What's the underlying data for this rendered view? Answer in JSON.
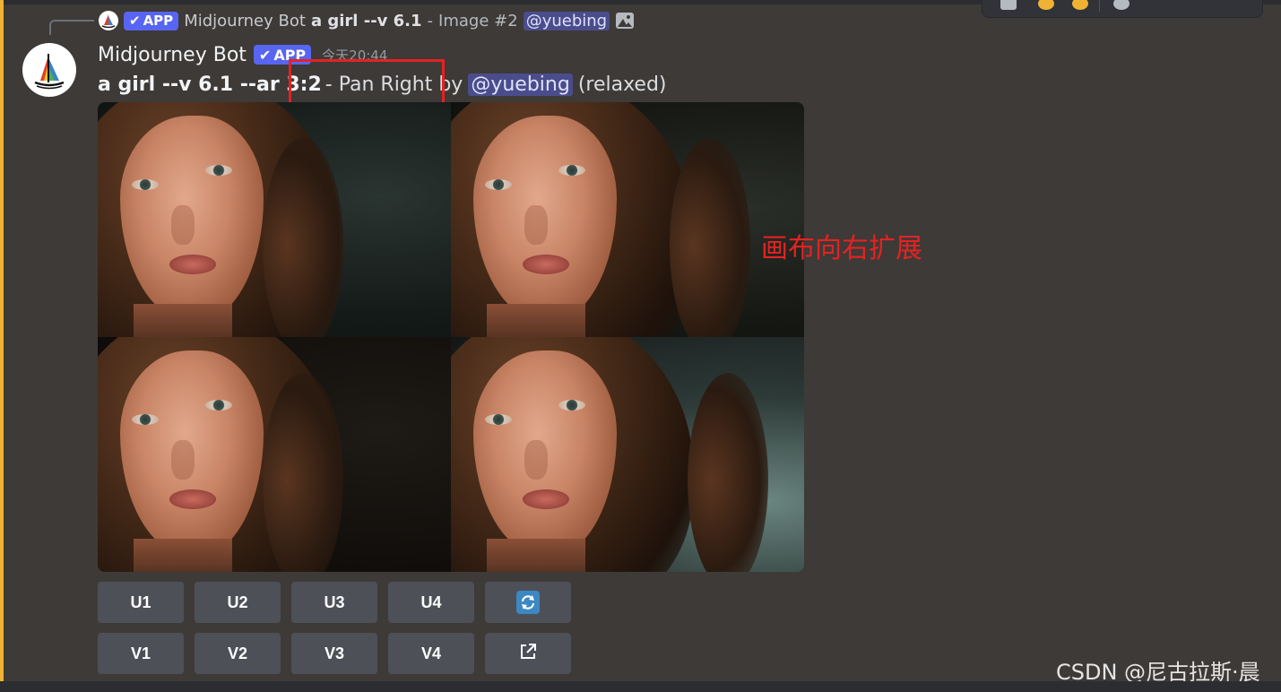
{
  "reply": {
    "author": "Midjourney Bot",
    "badge": "APP",
    "prompt": "a girl --v 6.1",
    "separator": "-",
    "image_ref": "Image #2",
    "mention": "@yuebing"
  },
  "message": {
    "author": "Midjourney Bot",
    "badge": "APP",
    "timestamp": "今天20:44",
    "prompt": "a girl --v 6.1 --ar 3:2",
    "action": "- Pan Right by",
    "mention": "@yuebing",
    "status": "(relaxed)"
  },
  "buttons": {
    "row1": [
      "U1",
      "U2",
      "U3",
      "U4"
    ],
    "row2": [
      "V1",
      "V2",
      "V3",
      "V4"
    ],
    "reroll_icon": "refresh-icon",
    "web_icon": "external-link-icon"
  },
  "annotation": "画布向右扩展",
  "watermark": "CSDN @尼古拉斯·晨",
  "colors": {
    "background": "#3e3a37",
    "accent_bar": "#f0b232",
    "app_badge": "#5865f2",
    "button": "#4e5058",
    "highlight": "#e52221"
  }
}
